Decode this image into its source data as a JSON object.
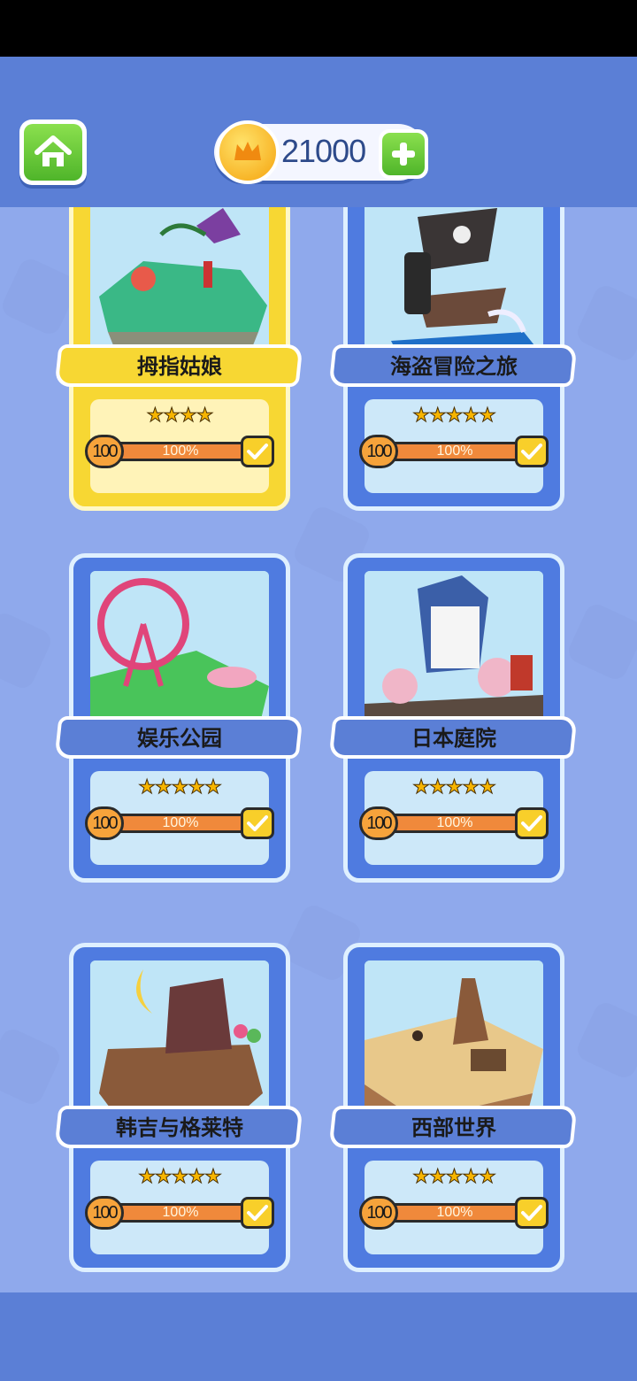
{
  "header": {
    "coins": "21000"
  },
  "colors": {
    "accent": "#5b7fd6",
    "selected": "#f7d733",
    "progress": "#f0893b",
    "button_green": "#4fb52a"
  },
  "icons": {
    "home": "home-icon",
    "coin": "crown-coin-icon",
    "add": "plus-icon",
    "done": "checkmark-icon",
    "star": "star-icon"
  },
  "levels": [
    {
      "title": "拇指姑娘",
      "stars": "★★★★",
      "stars_count": 4,
      "level": "100",
      "progress": "100%",
      "selected": true
    },
    {
      "title": "海盗冒险之旅",
      "stars": "★★★★★",
      "stars_count": 5,
      "level": "100",
      "progress": "100%",
      "selected": false
    },
    {
      "title": "娱乐公园",
      "stars": "★★★★★",
      "stars_count": 5,
      "level": "100",
      "progress": "100%",
      "selected": false
    },
    {
      "title": "日本庭院",
      "stars": "★★★★★",
      "stars_count": 5,
      "level": "100",
      "progress": "100%",
      "selected": false
    },
    {
      "title": "韩吉与格莱特",
      "stars": "★★★★★",
      "stars_count": 5,
      "level": "100",
      "progress": "100%",
      "selected": false
    },
    {
      "title": "西部世界",
      "stars": "★★★★★",
      "stars_count": 5,
      "level": "100",
      "progress": "100%",
      "selected": false
    }
  ]
}
